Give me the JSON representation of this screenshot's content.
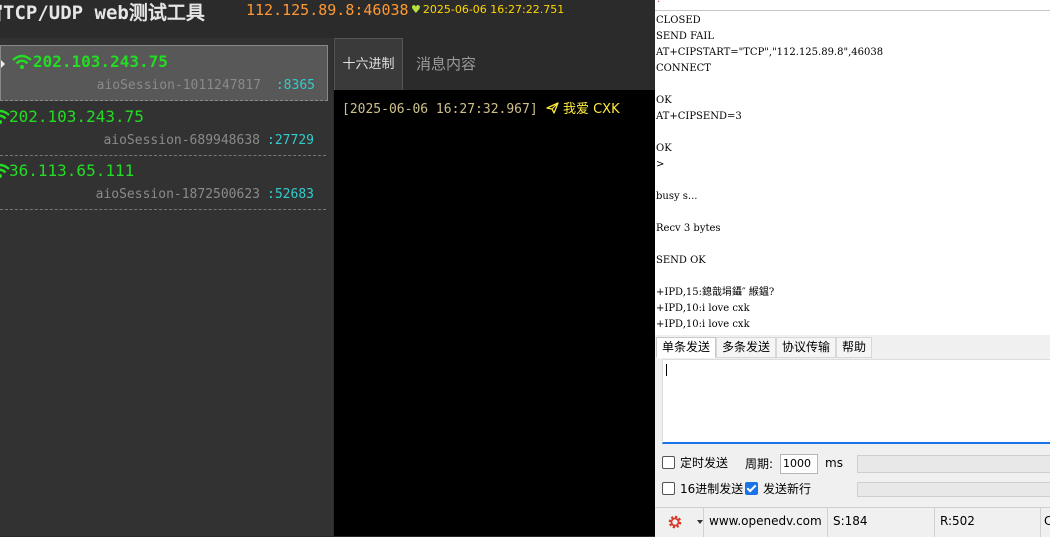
{
  "web": {
    "title": "宙TCP/UDP web测试工具",
    "address": "112.125.89.8:46038",
    "datetime": "2025-06-06 16:27:22.751",
    "sessions": [
      {
        "ip": "202.103.243.75",
        "session_id": "aioSession-1011247817",
        "port": ":8365"
      },
      {
        "ip": "202.103.243.75",
        "session_id": "aioSession-689948638",
        "port": ":27729"
      },
      {
        "ip": "36.113.65.111",
        "session_id": "aioSession-1872500623",
        "port": ":52683"
      }
    ],
    "hex_button": "十六进制",
    "message_label": "消息内容",
    "chat": [
      {
        "timestamp": "[2025-06-06 16:27:32.967]",
        "text": "我爱 CXK"
      }
    ]
  },
  "serial": {
    "recv_lines": [
      "CLOSED",
      "SEND FAIL",
      "AT+CIPSTART=\"TCP\",\"112.125.89.8\",46038",
      "CONNECT",
      "",
      "OK",
      "AT+CIPSEND=3",
      "",
      "OK",
      ">",
      "",
      "busy s...",
      "",
      "Recv 3 bytes",
      "",
      "SEND OK",
      "",
      "+IPD,15:鎴戠埍鑷″ 緱鎾?",
      "+IPD,10:i love cxk",
      "+IPD,10:i love cxk"
    ],
    "send_tabs": [
      "单条发送",
      "多条发送",
      "协议传输",
      "帮助"
    ],
    "timed_send": "定时发送",
    "period_label": "周期:",
    "period_value": "1000",
    "period_unit": "ms",
    "hex_send": "16进制发送",
    "newline_send": "发送新行",
    "status": {
      "website": "www.openedv.com",
      "sent": "S:184",
      "received": "R:502",
      "extra": "C"
    }
  }
}
